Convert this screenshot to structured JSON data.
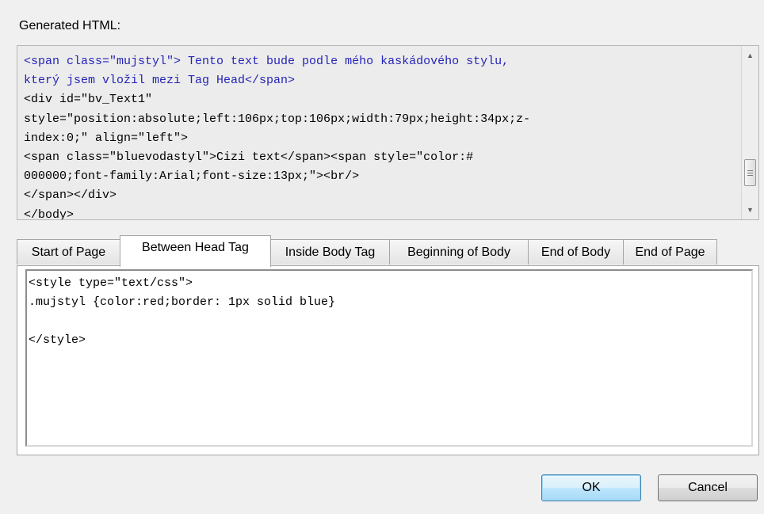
{
  "generated_label": "Generated HTML:",
  "generated_code": {
    "blue_lines": [
      "<span class=\"mujstyl\"> Tento text bude podle mého kaskádového stylu,",
      "který jsem vložil mezi Tag Head</span>"
    ],
    "lines": [
      "<div id=\"bv_Text1\"",
      "style=\"position:absolute;left:106px;top:106px;width:79px;height:34px;z-",
      "index:0;\" align=\"left\">",
      "<span class=\"bluevodastyl\">Cizi text</span><span style=\"color:#",
      "000000;font-family:Arial;font-size:13px;\"><br/>",
      "</span></div>",
      "</body>"
    ]
  },
  "tabs": [
    {
      "label": "Start of Page"
    },
    {
      "label": "Between Head Tag"
    },
    {
      "label": "Inside Body Tag"
    },
    {
      "label": "Beginning of Body"
    },
    {
      "label": "End of Body"
    },
    {
      "label": "End of Page"
    }
  ],
  "active_tab": "Between Head Tag",
  "editor_lines": [
    "<style type=\"text/css\">",
    ".mujstyl {color:red;border: 1px solid blue}",
    "",
    "</style>"
  ],
  "buttons": {
    "ok": "OK",
    "cancel": "Cancel"
  },
  "scrollbar_icons": [
    "scroll-up-icon",
    "scroll-down-icon",
    "scroll-grip-icon"
  ],
  "colors": {
    "code_blue": "#2424b8",
    "dialog_bg": "#f0f0f0",
    "ok_accent": "#3c7fb1"
  }
}
